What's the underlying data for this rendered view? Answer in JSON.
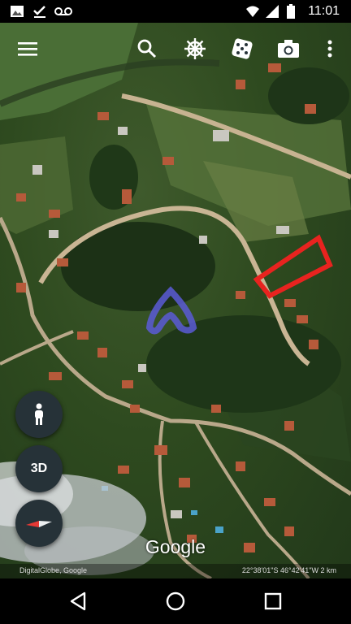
{
  "status_bar": {
    "time": "11:01",
    "icons": [
      "image-icon",
      "check-download-icon",
      "voicemail-icon",
      "wifi-icon",
      "signal-icon",
      "battery-icon"
    ]
  },
  "toolbar": {
    "buttons": [
      "menu-icon",
      "search-icon",
      "voyager-wheel-icon",
      "feeling-lucky-dice-icon",
      "camera-icon",
      "more-vert-icon"
    ]
  },
  "map": {
    "highlight_color": "#e8231f",
    "location_marker_color": "#5a5ad6"
  },
  "controls": {
    "three_d_label": "3D",
    "pegman": "pegman-icon",
    "compass": "compass-icon"
  },
  "brand": {
    "logo_text": "Google"
  },
  "attribution": {
    "provider": "DigitalGlobe, Google",
    "coordinates": "22°38'01\"S 46°42'41\"W 2 km"
  },
  "nav_bar": {
    "buttons": [
      "back-icon",
      "home-icon",
      "recents-icon"
    ]
  }
}
